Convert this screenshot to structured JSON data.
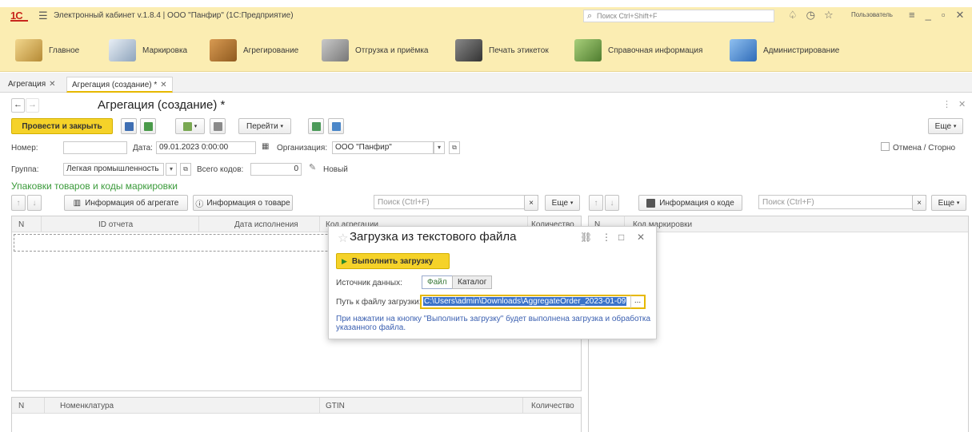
{
  "titlebar": {
    "logo": "1С",
    "title": "Электронный кабинет v.1.8.4 | ООО \"Панфир\" (1С:Предприятие)",
    "search_placeholder": "Поиск Ctrl+Shift+F",
    "user": "Пользователь"
  },
  "sections": [
    {
      "label": "Главное",
      "color": "#d7b25a"
    },
    {
      "label": "Маркировка",
      "color": "#9fb4c9"
    },
    {
      "label": "Агрегирование",
      "color": "#b0742f"
    },
    {
      "label": "Отгрузка и приёмка",
      "color": "#8c8c8c"
    },
    {
      "label": "Печать этикеток",
      "color": "#555555"
    },
    {
      "label": "Справочная информация",
      "color": "#7aa357"
    },
    {
      "label": "Администрирование",
      "color": "#4d8bd6"
    }
  ],
  "tabs": [
    {
      "label": "Агрегация"
    },
    {
      "label": "Агрегация (создание) *"
    }
  ],
  "form": {
    "title": "Агрегация (создание) *",
    "post_close_label": "Провести и закрыть",
    "goto_label": "Перейти",
    "more_label": "Еще",
    "number_label": "Номер:",
    "number_value": "",
    "date_label": "Дата:",
    "date_value": "09.01.2023  0:00:00",
    "org_label": "Организация:",
    "org_value": "ООО \"Панфир\"",
    "cancel_label": "Отмена / Сторно",
    "group_label": "Группа:",
    "group_value": "Легкая промышленность",
    "total_codes_label": "Всего кодов:",
    "total_codes_value": "0",
    "status_label": "Новый",
    "section_title": "Упаковки товаров и коды маркировки"
  },
  "left_table": {
    "aggregate_info_label": "Информация об агрегате",
    "product_info_label": "Информация о товаре",
    "search_placeholder": "Поиск (Ctrl+F)",
    "more_label": "Еще",
    "columns": [
      "N",
      "ID отчета",
      "Дата исполнения",
      "Код агрегации",
      "Количество"
    ]
  },
  "right_table": {
    "code_info_label": "Информация о коде",
    "search_placeholder": "Поиск (Ctrl+F)",
    "more_label": "Еще",
    "columns": [
      "N",
      "Код маркировки"
    ]
  },
  "bottom_table": {
    "columns": [
      "N",
      "Номенклатура",
      "GTIN",
      "Количество"
    ]
  },
  "dialog": {
    "title": "Загрузка из текстового файла",
    "run_label": "Выполнить загрузку",
    "source_label": "Источник данных:",
    "source_options": [
      "Файл",
      "Каталог"
    ],
    "source_selected": "Файл",
    "path_label": "Путь к файлу загрузки:",
    "path_value": "C:\\Users\\admin\\Downloads\\AggregateOrder_2023-01-09",
    "browse_label": "...",
    "hint": "При нажатии на кнопку \"Выполнить загрузку\" будет выполнена загрузка и обработка указанного файла."
  }
}
